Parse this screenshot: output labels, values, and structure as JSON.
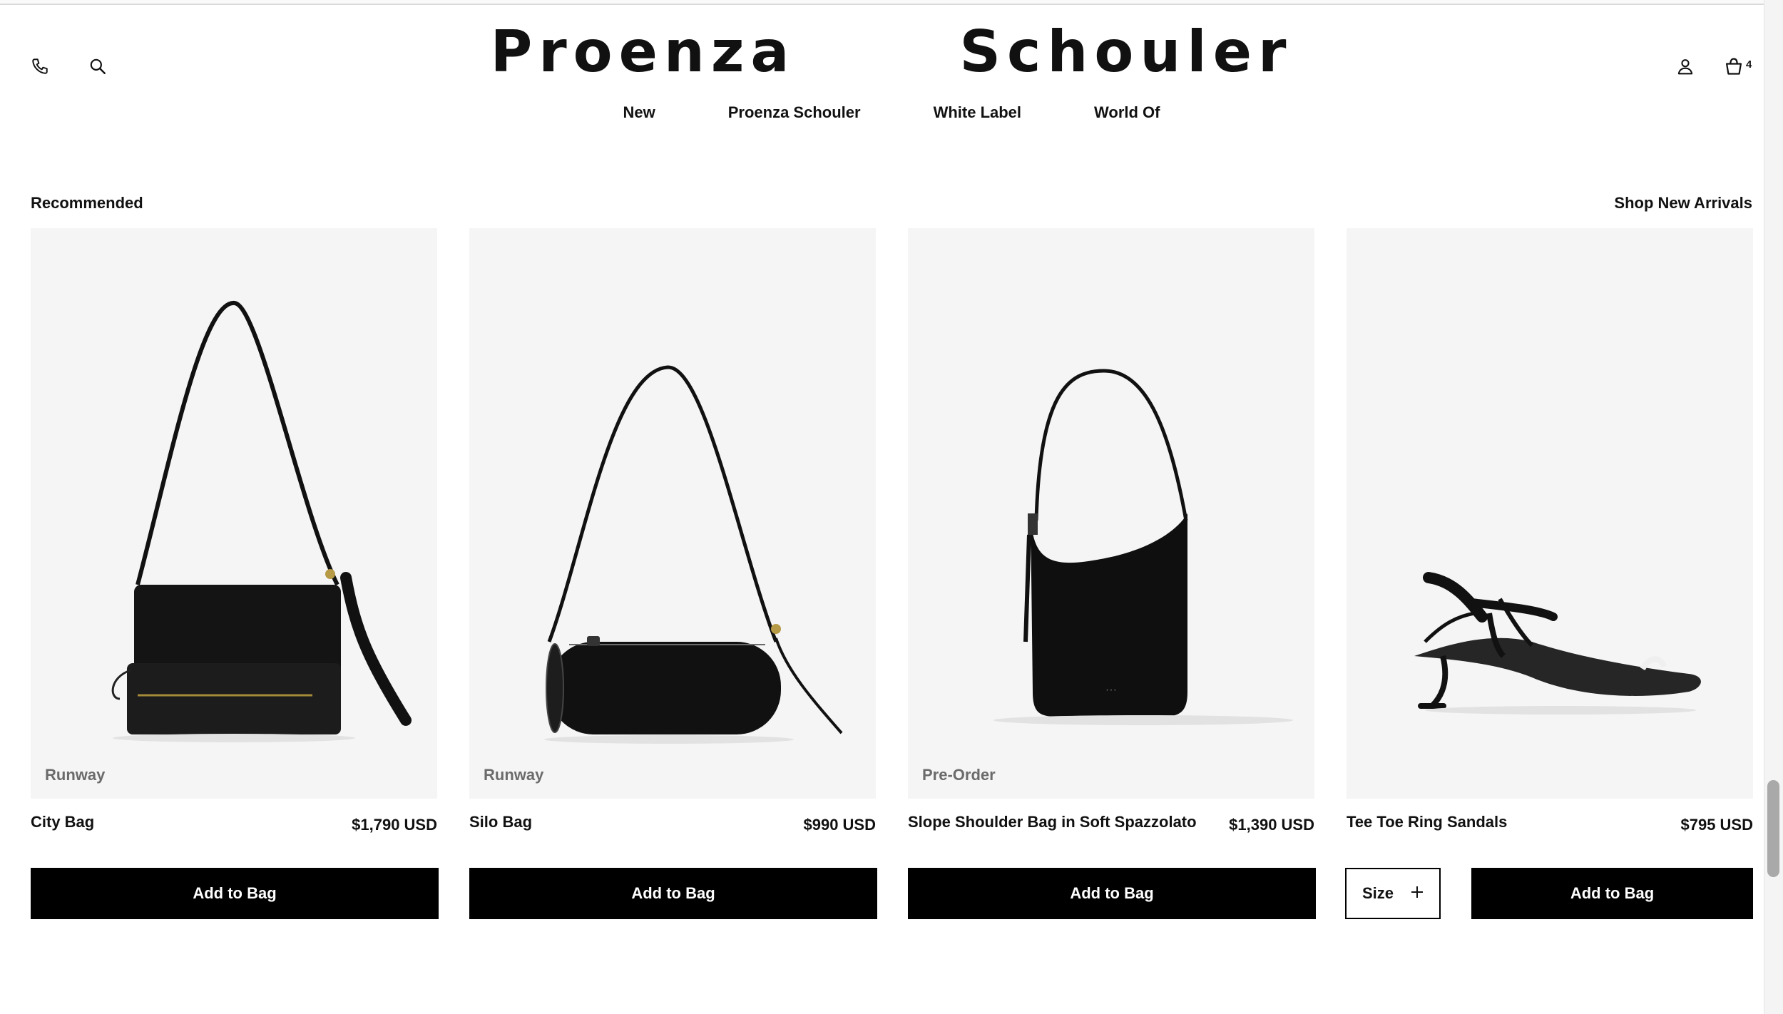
{
  "header": {
    "logo_word1": "Proenza",
    "logo_word2": "Schouler",
    "cart_count": "4",
    "icons": [
      "phone-icon",
      "search-icon",
      "account-icon",
      "shopping-bag-icon"
    ]
  },
  "nav": {
    "items": [
      {
        "label": "New"
      },
      {
        "label": "Proenza Schouler"
      },
      {
        "label": "White Label"
      },
      {
        "label": "World Of"
      }
    ]
  },
  "section": {
    "title": "Recommended",
    "link": "Shop New Arrivals"
  },
  "products": [
    {
      "badge": "Runway",
      "name": "City Bag",
      "price": "$1,790 USD",
      "button": "Add to Bag"
    },
    {
      "badge": "Runway",
      "name": "Silo Bag",
      "price": "$990 USD",
      "button": "Add to Bag"
    },
    {
      "badge": "Pre-Order",
      "name": "Slope Shoulder Bag in Soft Spazzolato",
      "price": "$1,390 USD",
      "button": "Add to Bag"
    },
    {
      "badge": "",
      "name": "Tee Toe Ring Sandals",
      "price": "$795 USD",
      "button": "Add to Bag",
      "size_label": "Size"
    }
  ],
  "colors": {
    "accent": "#000000",
    "card_bg": "#f5f5f5",
    "badge": "#6b6b6b"
  }
}
